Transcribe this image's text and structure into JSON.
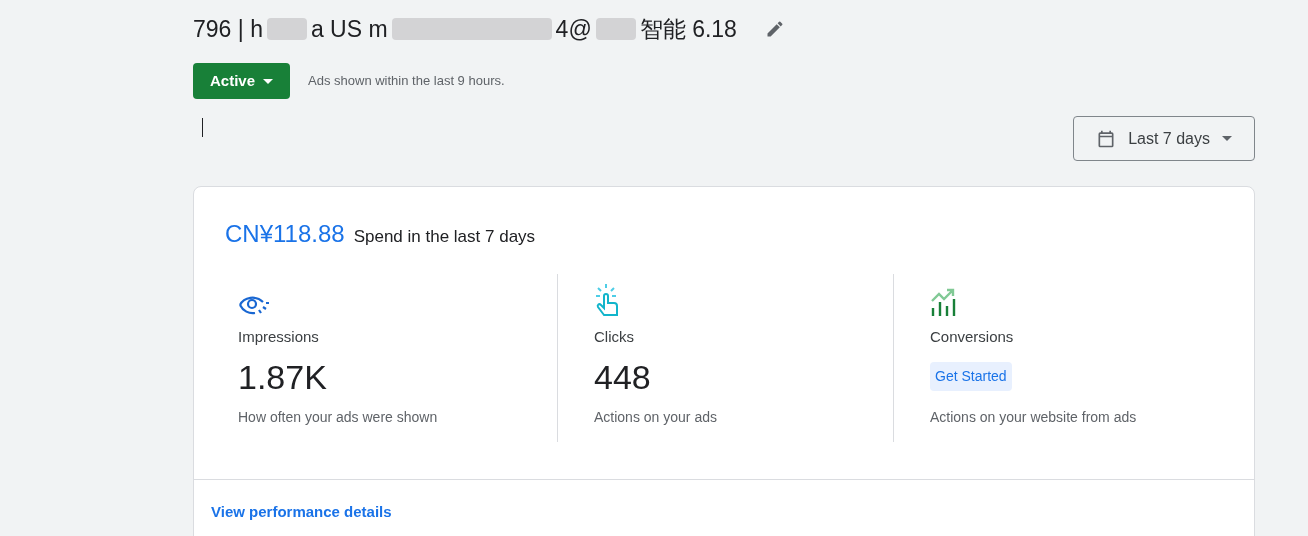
{
  "title_fragments": [
    "796 | h",
    "a US m",
    "4@",
    "智能 6.18"
  ],
  "status": {
    "label": "Active",
    "note": "Ads shown within the last 9 hours."
  },
  "date_range": {
    "label": "Last 7 days"
  },
  "spend": {
    "amount": "CN¥118.88",
    "label": "Spend in the last 7 days"
  },
  "metrics": [
    {
      "kind": "impressions",
      "label": "Impressions",
      "value": "1.87K",
      "description": "How often your ads were shown"
    },
    {
      "kind": "clicks",
      "label": "Clicks",
      "value": "448",
      "description": "Actions on your ads"
    },
    {
      "kind": "conversions",
      "label": "Conversions",
      "action": "Get Started",
      "description": "Actions on your website from ads"
    }
  ],
  "footer_link": "View performance details"
}
